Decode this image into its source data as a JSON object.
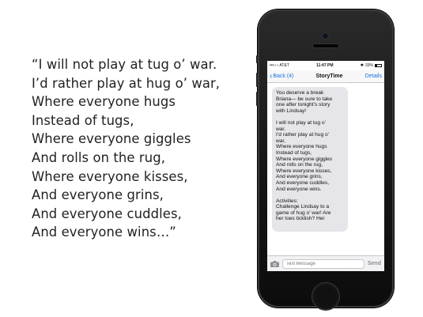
{
  "poem": {
    "lines": [
      "“I will not play at tug o’ war.",
      "I’d rather play at hug o’ war,",
      "Where everyone hugs",
      "Instead of tugs,",
      "Where everyone giggles",
      "And rolls on the rug,",
      "Where everyone kisses,",
      "And everyone grins,",
      "And everyone cuddles,",
      "And everyone wins…”"
    ]
  },
  "status_bar": {
    "carrier": "•••○○ AT&T",
    "time": "11:47 PM",
    "battery": "33%",
    "battery_level": 0.33
  },
  "nav": {
    "back_label": "Back (4)",
    "title": "StoryTime",
    "details_label": "Details"
  },
  "message": {
    "intro": [
      "You deserve a break",
      "Briana— be sure to take",
      "one after tonight’s story",
      "with Lindsay!"
    ],
    "poem": [
      "I will not play at tug o’",
      "war.",
      "I’d rather play at hug o’",
      "war,",
      "Where everyone hugs",
      "Instead of tugs,",
      "Where everyone giggles",
      "And rolls on the rug,",
      "Where everyone kisses,",
      "And everyone grins,",
      "And everyone cuddles,",
      "And everyone wins."
    ],
    "activities": [
      "Activities:",
      "Challenge Lindsay to a",
      "game of hug o’ war! Are",
      "her toes ticklish? Her"
    ]
  },
  "input": {
    "placeholder": "Text Message",
    "send_label": "Send"
  }
}
